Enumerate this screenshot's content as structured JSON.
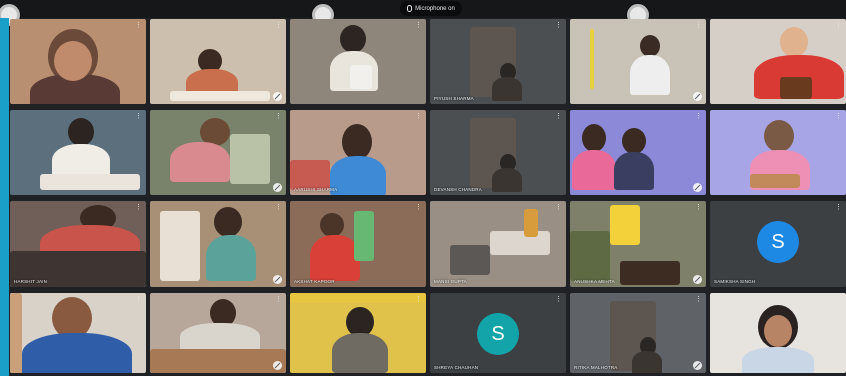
{
  "meeting": {
    "presenter_label": "Microphone on",
    "accent_color": "#1aa0c8"
  },
  "participants": [
    {
      "name": "",
      "type": "video",
      "bg": "#b98f72",
      "scene": "teacher"
    },
    {
      "name": "",
      "type": "video",
      "bg": "#cdbfae",
      "scene": "kid-table"
    },
    {
      "name": "",
      "type": "video",
      "bg": "#8e857b",
      "scene": "kid-cup"
    },
    {
      "name": "PIYUSH SHARMA",
      "type": "video",
      "bg": "#4b4f52",
      "scene": "dark-door"
    },
    {
      "name": "",
      "type": "video",
      "bg": "#c9c2b6",
      "scene": "kid-sitting"
    },
    {
      "name": "",
      "type": "video",
      "bg": "#d6cfc8",
      "scene": "kid-red"
    },
    {
      "name": "",
      "type": "video",
      "bg": "#5c6f7d",
      "scene": "kid-bowl"
    },
    {
      "name": "",
      "type": "video",
      "bg": "#79826a",
      "scene": "kid-plant"
    },
    {
      "name": "AARUSHI SHARMA",
      "type": "video",
      "bg": "#b89b8a",
      "scene": "girl-blue"
    },
    {
      "name": "DEVANSH CHANDRA",
      "type": "video",
      "bg": "#4b4f52",
      "scene": "dark-door"
    },
    {
      "name": "",
      "type": "video",
      "bg": "#8c89d8",
      "scene": "mom-kid"
    },
    {
      "name": "",
      "type": "video",
      "bg": "#a8a5e6",
      "scene": "kid-purple"
    },
    {
      "name": "HARSHIT JAIN",
      "type": "video",
      "bg": "#6f5f58",
      "scene": "kid-hands"
    },
    {
      "name": "",
      "type": "video",
      "bg": "#a89077",
      "scene": "girl-jar"
    },
    {
      "name": "AKSHAT KAPOOR",
      "type": "video",
      "bg": "#8b6c58",
      "scene": "kid-spray"
    },
    {
      "name": "MANSI GUPTA",
      "type": "video",
      "bg": "#9a8f84",
      "scene": "hands-glass"
    },
    {
      "name": "ANUSHKA MEHTA",
      "type": "video",
      "bg": "#7e8069",
      "scene": "bowl-plant"
    },
    {
      "name": "SAMIKSHA SINGH",
      "type": "avatar",
      "initial": "S",
      "color": "#1e88e5"
    },
    {
      "name": "",
      "type": "video",
      "bg": "#d8d2c8",
      "scene": "boy-blue"
    },
    {
      "name": "",
      "type": "video",
      "bg": "#b7a79a",
      "scene": "girl-table"
    },
    {
      "name": "",
      "type": "video",
      "bg": "#e0c24a",
      "scene": "girl-yellow"
    },
    {
      "name": "SHREYA CHAUHAN",
      "type": "avatar",
      "initial": "S",
      "color": "#12a4a8"
    },
    {
      "name": "RITIKA MALHOTRA",
      "type": "video",
      "bg": "#5f6368",
      "scene": "dark-door"
    },
    {
      "name": "",
      "type": "video",
      "bg": "#e7e3df",
      "scene": "girl-glasses"
    }
  ]
}
